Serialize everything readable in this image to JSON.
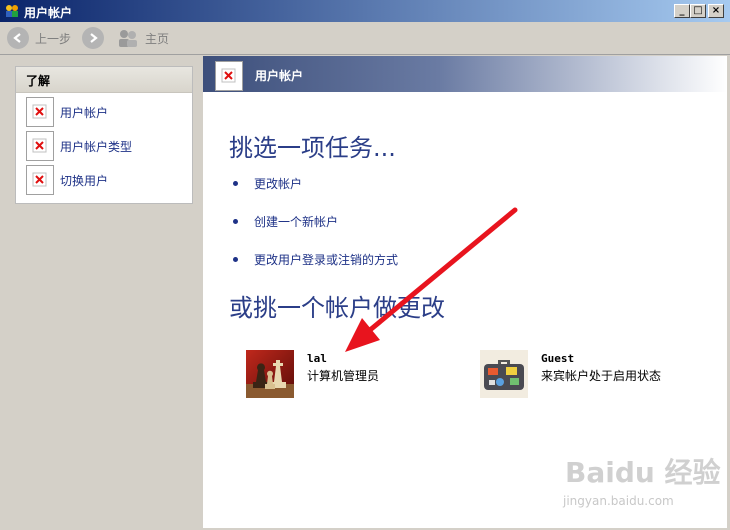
{
  "window": {
    "title": "用户帐户"
  },
  "toolbar": {
    "back_label": "上一步",
    "home_label": "主页"
  },
  "sidebar": {
    "heading": "了解",
    "items": [
      {
        "label": "用户帐户"
      },
      {
        "label": "用户帐户类型"
      },
      {
        "label": "切换用户"
      }
    ]
  },
  "main": {
    "banner_title": "用户帐户",
    "task_heading": "挑选一项任务...",
    "tasks": [
      {
        "label": "更改帐户"
      },
      {
        "label": "创建一个新帐户"
      },
      {
        "label": "更改用户登录或注销的方式"
      }
    ],
    "account_heading": "或挑一个帐户做更改",
    "accounts": [
      {
        "name": "lal",
        "description": "计算机管理员",
        "icon": "chess-icon"
      },
      {
        "name": "Guest",
        "description": "来宾帐户处于启用状态",
        "icon": "suitcase-icon"
      }
    ]
  },
  "watermark": {
    "text": "Baidu 经验",
    "sub": "jingyan.baidu.com"
  },
  "colors": {
    "link": "#1e3287",
    "heading": "#2b3e88",
    "arrow": "#e8141e"
  }
}
